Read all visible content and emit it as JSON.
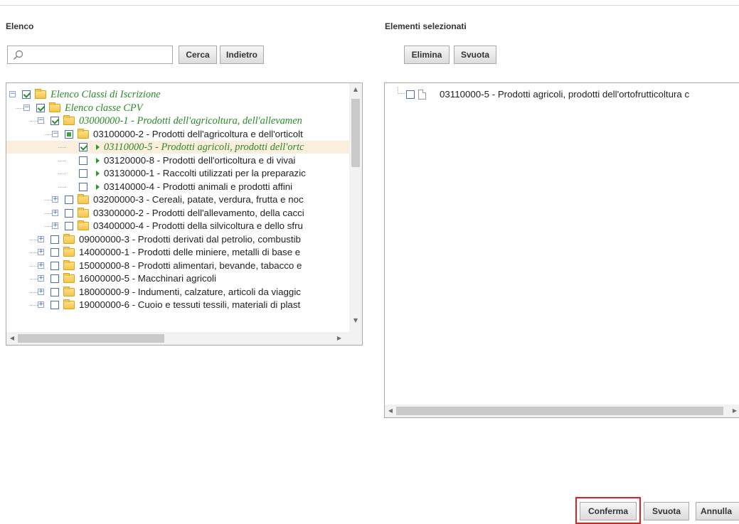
{
  "left": {
    "title": "Elenco",
    "search": {
      "value": "",
      "placeholder": ""
    },
    "search_button": "Cerca",
    "back_button": "Indietro",
    "tree": [
      {
        "label": "Elenco Classi di Iscrizione",
        "level": 0,
        "expander": "minus",
        "check": "checked",
        "style": "italic"
      },
      {
        "label": "Elenco classe CPV",
        "level": 1,
        "expander": "minus",
        "check": "checked",
        "style": "italic"
      },
      {
        "label": "03000000-1 - Prodotti dell'agricoltura, dell'allevamen",
        "level": 2,
        "expander": "minus",
        "check": "checked",
        "style": "italic"
      },
      {
        "label": "03100000-2 - Prodotti dell'agricoltura e dell'orticolt",
        "level": 3,
        "expander": "minus",
        "check": "partial",
        "style": "normal"
      },
      {
        "label": "03110000-5 - Prodotti agricoli, prodotti dell'ortc",
        "level": 4,
        "expander": "none",
        "check": "checked",
        "style": "italic",
        "selected": true
      },
      {
        "label": "03120000-8 - Prodotti dell'orticoltura e di vivai",
        "level": 4,
        "expander": "none",
        "check": "unchecked",
        "style": "normal"
      },
      {
        "label": "03130000-1 - Raccolti utilizzati per la preparazic",
        "level": 4,
        "expander": "none",
        "check": "unchecked",
        "style": "normal"
      },
      {
        "label": "03140000-4 - Prodotti animali e prodotti affini",
        "level": 4,
        "expander": "none",
        "check": "unchecked",
        "style": "normal"
      },
      {
        "label": "03200000-3 - Cereali, patate, verdura, frutta e noc",
        "level": 3,
        "expander": "plus",
        "check": "unchecked",
        "style": "normal"
      },
      {
        "label": "03300000-2 - Prodotti dell'allevamento, della cacci",
        "level": 3,
        "expander": "plus",
        "check": "unchecked",
        "style": "normal"
      },
      {
        "label": "03400000-4 - Prodotti della silvicoltura e dello sfru",
        "level": 3,
        "expander": "plus",
        "check": "unchecked",
        "style": "normal"
      },
      {
        "label": "09000000-3 - Prodotti derivati dal petrolio, combustib",
        "level": 2,
        "expander": "plus",
        "check": "unchecked",
        "style": "normal"
      },
      {
        "label": "14000000-1 - Prodotti delle miniere, metalli di base e",
        "level": 2,
        "expander": "plus",
        "check": "unchecked",
        "style": "normal"
      },
      {
        "label": "15000000-8 - Prodotti alimentari, bevande, tabacco e",
        "level": 2,
        "expander": "plus",
        "check": "unchecked",
        "style": "normal"
      },
      {
        "label": "16000000-5 - Macchinari agricoli",
        "level": 2,
        "expander": "plus",
        "check": "unchecked",
        "style": "normal"
      },
      {
        "label": "18000000-9 - Indumenti, calzature, articoli da viaggic",
        "level": 2,
        "expander": "plus",
        "check": "unchecked",
        "style": "normal"
      },
      {
        "label": "19000000-6 - Cuoio e tessuti tessili, materiali di plast",
        "level": 2,
        "expander": "plus",
        "check": "unchecked",
        "style": "normal"
      }
    ]
  },
  "right": {
    "title": "Elementi selezionati",
    "delete_button": "Elimina",
    "empty_button": "Svuota",
    "items": [
      {
        "label": "03110000-5 - Prodotti agricoli, prodotti dell'ortofrutticoltura c"
      }
    ]
  },
  "footer": {
    "confirm_button": "Conferma",
    "empty_button": "Svuota",
    "cancel_button": "Annulla"
  },
  "colors": {
    "accent_green": "#2a8a2a",
    "selection_bg": "#fbeedd",
    "highlight_red": "#e02020"
  }
}
